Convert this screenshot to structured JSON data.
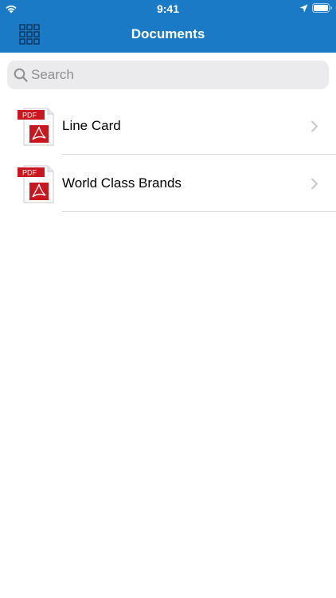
{
  "status_bar": {
    "time": "9:41",
    "icons": [
      "wifi-icon",
      "location-icon",
      "battery-icon"
    ]
  },
  "nav_bar": {
    "title": "Documents",
    "left_button_icon": "apps-grid-icon"
  },
  "search": {
    "placeholder": "Search",
    "value": ""
  },
  "documents": [
    {
      "label": "Line Card",
      "icon": "pdf-file-icon",
      "icon_text": "PDF"
    },
    {
      "label": "World Class Brands",
      "icon": "pdf-file-icon",
      "icon_text": "PDF"
    }
  ],
  "colors": {
    "header": "#1a7ac6",
    "pdf_red": "#c8171e",
    "chevron": "#c7c7cc",
    "separator": "#d8d8dc"
  }
}
